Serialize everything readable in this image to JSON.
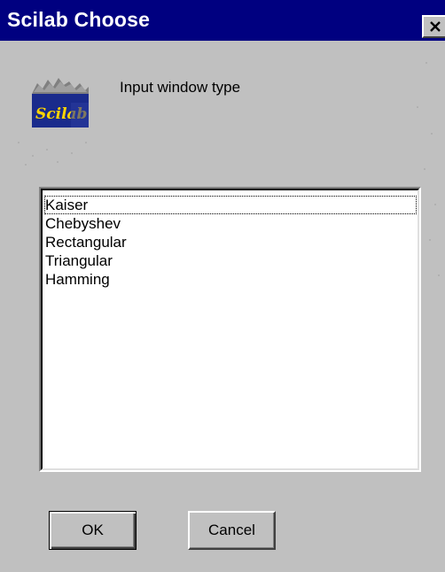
{
  "window": {
    "title": "Scilab Choose",
    "close_icon": "close-icon"
  },
  "header": {
    "logo_text": "Scilab",
    "logo_icon": "scilab-logo-icon",
    "prompt": "Input window type"
  },
  "list": {
    "items": [
      "Kaiser",
      "Chebyshev",
      "Rectangular",
      "Triangular",
      "Hamming"
    ],
    "focused_index": 0
  },
  "buttons": {
    "ok_label": "OK",
    "cancel_label": "Cancel"
  },
  "colors": {
    "titlebar": "#000080",
    "face": "#c0c0c0",
    "list_bg": "#ffffff"
  }
}
